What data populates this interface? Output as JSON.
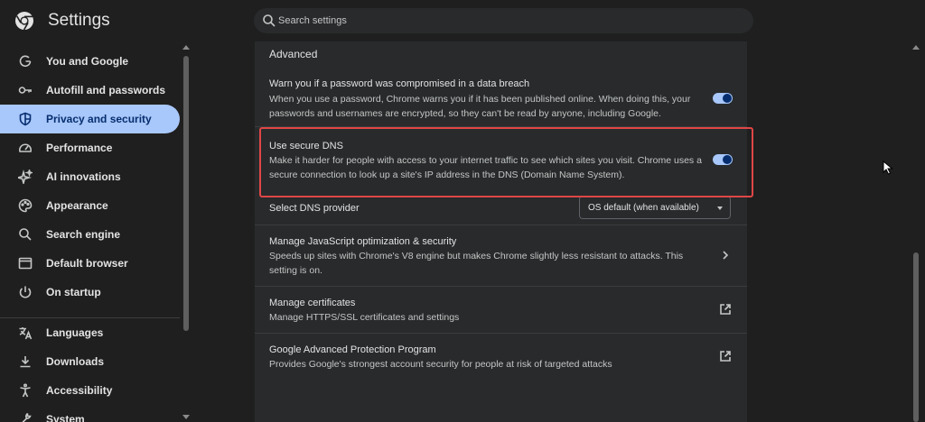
{
  "header": {
    "title": "Settings",
    "search_placeholder": "Search settings"
  },
  "sidebar": {
    "items": [
      {
        "label": "You and Google",
        "icon": "google-g-icon",
        "active": false
      },
      {
        "label": "Autofill and passwords",
        "icon": "key-icon",
        "active": false
      },
      {
        "label": "Privacy and security",
        "icon": "shield-icon",
        "active": true
      },
      {
        "label": "Performance",
        "icon": "speedometer-icon",
        "active": false
      },
      {
        "label": "AI innovations",
        "icon": "sparkle-icon",
        "active": false
      },
      {
        "label": "Appearance",
        "icon": "palette-icon",
        "active": false
      },
      {
        "label": "Search engine",
        "icon": "search-icon",
        "active": false
      },
      {
        "label": "Default browser",
        "icon": "browser-window-icon",
        "active": false
      },
      {
        "label": "On startup",
        "icon": "power-icon",
        "active": false
      },
      {
        "label": "Languages",
        "icon": "translate-icon",
        "active": false
      },
      {
        "label": "Downloads",
        "icon": "download-icon",
        "active": false
      },
      {
        "label": "Accessibility",
        "icon": "accessibility-icon",
        "active": false
      },
      {
        "label": "System",
        "icon": "wrench-icon",
        "active": false
      }
    ]
  },
  "main": {
    "section_title": "Advanced",
    "rows": {
      "password_warn": {
        "title": "Warn you if a password was compromised in a data breach",
        "desc": "When you use a password, Chrome warns you if it has been published online. When doing this, your passwords and usernames are encrypted, so they can't be read by anyone, including Google.",
        "enabled": true
      },
      "secure_dns": {
        "title": "Use secure DNS",
        "desc": "Make it harder for people with access to your internet traffic to see which sites you visit. Chrome uses a secure connection to look up a site's IP address in the DNS (Domain Name System).",
        "enabled": true
      },
      "dns_provider": {
        "title": "Select DNS provider",
        "selected": "OS default (when available)"
      },
      "js_optimization": {
        "title": "Manage JavaScript optimization & security",
        "desc": "Speeds up sites with Chrome's V8 engine but makes Chrome slightly less resistant to attacks. This setting is on."
      },
      "certificates": {
        "title": "Manage certificates",
        "desc": "Manage HTTPS/SSL certificates and settings"
      },
      "advanced_protection": {
        "title": "Google Advanced Protection Program",
        "desc": "Provides Google's strongest account security for people at risk of targeted attacks"
      }
    }
  },
  "colors": {
    "accent": "#a8c7fa",
    "highlight_border": "#e04646",
    "background": "#1f1f1f",
    "card": "#282a2c"
  }
}
